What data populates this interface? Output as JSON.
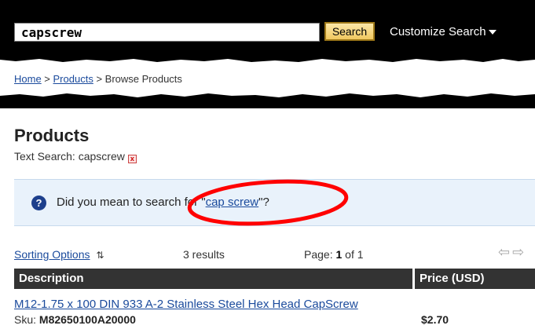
{
  "search": {
    "value": "capscrew",
    "button_label": "Search",
    "customize_label": "Customize Search"
  },
  "breadcrumb": {
    "home": "Home",
    "sep1": " > ",
    "products": "Products",
    "sep2": " > ",
    "current": "Browse Products"
  },
  "page": {
    "title": "Products",
    "text_search_label": "Text Search: capscrew",
    "clear_icon": "close-icon"
  },
  "suggestion": {
    "prefix": "Did you mean to search for \"",
    "term": "cap screw",
    "suffix": "\"?"
  },
  "results_bar": {
    "sorting_label": "Sorting Options",
    "sorting_icon": "⇅",
    "results_count": "3 results",
    "page_prefix": "Page: ",
    "page_current": "1",
    "page_suffix": " of 1",
    "prev_icon": "⇦",
    "next_icon": "⇨"
  },
  "table": {
    "headers": {
      "description": "Description",
      "price": "Price (USD)"
    },
    "rows": [
      {
        "description": "M12-1.75 x 100 DIN 933 A-2 Stainless Steel Hex Head CapScrew",
        "sku_label": "Sku: ",
        "sku": "M82650100A20000",
        "price": "$2.70"
      }
    ]
  },
  "colors": {
    "header_bg": "#000000",
    "link": "#1a4a9c",
    "suggest_bg": "#e9f2fb",
    "annotation_red": "#ff0000"
  }
}
